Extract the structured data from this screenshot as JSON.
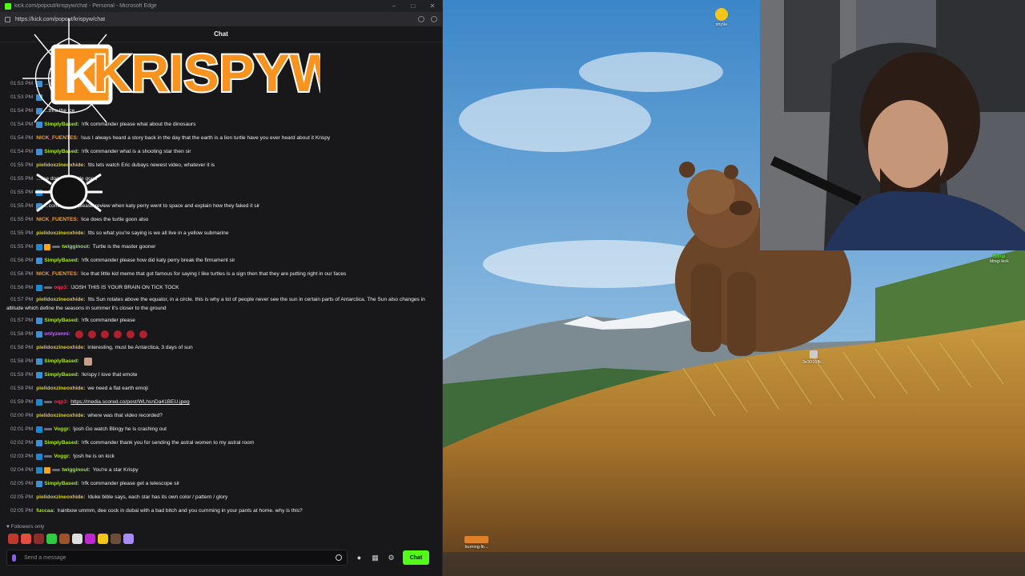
{
  "browser": {
    "window_title": "kick.com/popout/krispyw/chat - Personal - Microsoft Edge",
    "url": "https://kick.com/popout/krispyw/chat",
    "chat_header": "Chat"
  },
  "overlay": {
    "logo_text": "KRISPYW",
    "logo_letter": "K"
  },
  "messages": [
    {
      "time": "01:53 PM",
      "user": "",
      "color": "#efeff1",
      "badges": [
        "sub"
      ],
      "text": "...re it c... ...g in the water"
    },
    {
      "time": "01:53 PM",
      "user": "",
      "color": "#efeff1",
      "badges": [
        "sub"
      ],
      "text": ""
    },
    {
      "time": "01:54 PM",
      "user": "",
      "color": "#efeff1",
      "badges": [
        "sub"
      ],
      "text": "...thru the ice"
    },
    {
      "time": "01:54 PM",
      "user": "SimplyBased:",
      "color": "#a6e22e",
      "badges": [
        "sub"
      ],
      "text": "!rfk commander please what about the dinosaurs"
    },
    {
      "time": "01:54 PM",
      "user": "NICK_FUENTES:",
      "color": "#f29d35",
      "badges": [],
      "text": "!sus I always heard a story back in the day that the earth is a lion turtle have you ever heard about it Krispy"
    },
    {
      "time": "01:54 PM",
      "user": "SimplyBased:",
      "color": "#a6e22e",
      "badges": [
        "sub"
      ],
      "text": "!rfk commander what is a shooting star then sir"
    },
    {
      "time": "01:55 PM",
      "user": "pielidoxzineoxhide:",
      "color": "#d8c93a",
      "badges": [],
      "text": "!tts lets watch Eric dubays newest video, whatever it is"
    },
    {
      "time": "01:55 PM",
      "user": "",
      "color": "#efeff1",
      "badges": [],
      "text": "...!ice does the turtle good"
    },
    {
      "time": "01:55 PM",
      "user": "",
      "color": "#efeff1",
      "badges": [
        "gift"
      ],
      "text": "...Mmm"
    },
    {
      "time": "01:55 PM",
      "user": "",
      "color": "#efeff1",
      "badges": [
        "sub"
      ],
      "text": "...commander please review when katy perry went to space and explain how they faked it sir"
    },
    {
      "time": "01:55 PM",
      "user": "NICK_FUENTES:",
      "color": "#f29d35",
      "badges": [],
      "text": "!ice does the turtle goon also"
    },
    {
      "time": "01:55 PM",
      "user": "pielidoxzineoxhide:",
      "color": "#d8c93a",
      "badges": [],
      "text": "!tts so what you're saying is we all live in a yellow submarine"
    },
    {
      "time": "01:55 PM",
      "user": "twigginout:",
      "color": "#a6e22e",
      "badges": [
        "gift",
        "crown",
        "og"
      ],
      "text": "Turtle is the master gooner"
    },
    {
      "time": "01:56 PM",
      "user": "SimplyBased:",
      "color": "#a6e22e",
      "badges": [
        "sub"
      ],
      "text": "!rfk commander please how did katy perry break the firmament sir"
    },
    {
      "time": "01:56 PM",
      "user": "NICK_FUENTES:",
      "color": "#f29d35",
      "badges": [],
      "text": "!ice that little kid meme that got famous for saying I like turtles is a sign then that they are putting right in our faces"
    },
    {
      "time": "01:56 PM",
      "user": "oqp3:",
      "color": "#e0354a",
      "badges": [
        "gift",
        "og"
      ],
      "text": "!JOSH THIS IS YOUR BRAIN ON TICK TOCK"
    },
    {
      "time": "01:57 PM",
      "user": "pielidoxzineoxhide:",
      "color": "#d8c93a",
      "badges": [],
      "text": "!tts Sun rotates above the equator, in a circle. this is why a lot of people never see the sun in certain parts of Antarctica. The Sun also changes in altitude which define the seasons in summer it's closer to the ground",
      "wrap": true
    },
    {
      "time": "01:57 PM",
      "user": "SimplyBased:",
      "color": "#a6e22e",
      "badges": [
        "sub"
      ],
      "text": "!rfk commander please"
    },
    {
      "time": "01:58 PM",
      "user": "onlyzenni:",
      "color": "#c26cf2",
      "badges": [
        "sub"
      ],
      "text": "",
      "emotes": 6
    },
    {
      "time": "01:58 PM",
      "user": "pielidoxzineoxhide:",
      "color": "#d8c93a",
      "badges": [],
      "text": "interesting, must be Antarctica, 3 days of sun"
    },
    {
      "time": "01:58 PM",
      "user": "SimplyBased:",
      "color": "#a6e22e",
      "badges": [
        "sub"
      ],
      "text": "",
      "emotes_pale": 1
    },
    {
      "time": "01:59 PM",
      "user": "SimplyBased:",
      "color": "#a6e22e",
      "badges": [
        "sub"
      ],
      "text": "!krispy I love that emote"
    },
    {
      "time": "01:59 PM",
      "user": "pielidoxzineoxhide:",
      "color": "#d8c93a",
      "badges": [],
      "text": "we need a flat earth emoji"
    },
    {
      "time": "01:59 PM",
      "user": "oqp3:",
      "color": "#e0354a",
      "badges": [
        "gift",
        "og"
      ],
      "text": "https://media.scored.co/post/WLhsnDa41BEU.jpeg",
      "link": true
    },
    {
      "time": "02:00 PM",
      "user": "pielidoxzineoxhide:",
      "color": "#d8c93a",
      "badges": [],
      "text": "where was that video recorded?"
    },
    {
      "time": "02:01 PM",
      "user": "Voggr:",
      "color": "#a6e22e",
      "badges": [
        "gift",
        "og"
      ],
      "text": "!josh Go watch Blingy he is crashing out"
    },
    {
      "time": "02:02 PM",
      "user": "SimplyBased:",
      "color": "#a6e22e",
      "badges": [
        "sub"
      ],
      "text": "!rfk commander thank you for sending the astral women to my astral room"
    },
    {
      "time": "02:03 PM",
      "user": "Voggr:",
      "color": "#a6e22e",
      "badges": [
        "gift",
        "og"
      ],
      "text": "!josh he is on kick"
    },
    {
      "time": "02:04 PM",
      "user": "twigginout:",
      "color": "#a6e22e",
      "badges": [
        "gift",
        "crown",
        "og"
      ],
      "text": "You're a star Krispy"
    },
    {
      "time": "02:05 PM",
      "user": "SimplyBased:",
      "color": "#a6e22e",
      "badges": [
        "sub"
      ],
      "text": "!rfk commander please get a telescope sir"
    },
    {
      "time": "02:05 PM",
      "user": "pielidoxzineoxhide:",
      "color": "#d8c93a",
      "badges": [],
      "text": "!duke bible says, each star has its own color / pattern / glory"
    },
    {
      "time": "02:05 PM",
      "user": "fuccaa:",
      "color": "#a6e22e",
      "badges": [],
      "text": "!rainbow ummm, dee cock in dubai with a bad bitch and you cumming in your pants at home. why is this?"
    }
  ],
  "footer": {
    "followers_only": "Followers only",
    "message_placeholder": "Send a message",
    "chat_button": "Chat"
  },
  "desktop_icons": [
    {
      "label": "shy9e",
      "icon": "face-emoji-icon",
      "color": "#f5c518"
    },
    {
      "label": "3e3016ffc...",
      "icon": "file-icon",
      "color": "#cccccc"
    },
    {
      "label": "burning-fir...",
      "icon": "image-file-icon",
      "color": "#e0802a"
    }
  ],
  "kick_overlay": {
    "name": "Blingi",
    "sub": "blingi kick"
  },
  "colors": {
    "kick_green": "#53fc18",
    "chat_bg": "#18181b",
    "logo_orange": "#f7931e"
  }
}
